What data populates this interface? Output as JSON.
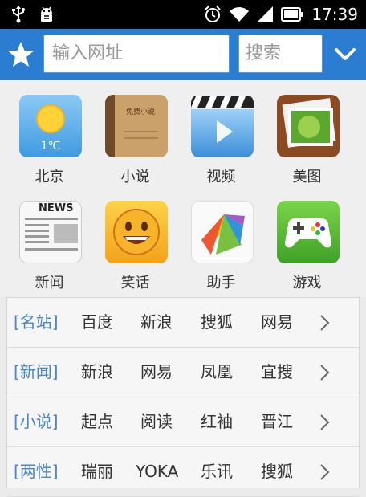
{
  "status_bar": {
    "time": "17:39",
    "icons": [
      "usb-icon",
      "android-debug-icon",
      "alarm-icon",
      "wifi-icon",
      "signal-icon",
      "battery-icon"
    ]
  },
  "toolbar": {
    "url_placeholder": "输入网址",
    "search_label": "搜索",
    "icons": [
      "star-icon",
      "chevron-down-icon"
    ]
  },
  "grid": {
    "items": [
      {
        "label": "北京",
        "icon": "weather-sun-icon",
        "badge": "1℃"
      },
      {
        "label": "小说",
        "icon": "book-icon",
        "badge": "免费小说"
      },
      {
        "label": "视频",
        "icon": "video-clapper-icon"
      },
      {
        "label": "美图",
        "icon": "photo-gallery-icon"
      },
      {
        "label": "新闻",
        "icon": "newspaper-icon",
        "badge": "NEWS"
      },
      {
        "label": "笑话",
        "icon": "smiley-icon"
      },
      {
        "label": "助手",
        "icon": "app-assistant-icon"
      },
      {
        "label": "游戏",
        "icon": "gamepad-icon"
      }
    ]
  },
  "links": {
    "rows": [
      {
        "category": "[名站]",
        "links": [
          "百度",
          "新浪",
          "搜狐",
          "网易"
        ]
      },
      {
        "category": "[新闻]",
        "links": [
          "新浪",
          "网易",
          "凤凰",
          "宜搜"
        ]
      },
      {
        "category": "[小说]",
        "links": [
          "起点",
          "阅读",
          "红袖",
          "晋江"
        ]
      },
      {
        "category": "[两性]",
        "links": [
          "瑞丽",
          "YOKA",
          "乐讯",
          "搜狐"
        ]
      }
    ]
  },
  "colors": {
    "toolbar": "#2a7dd0",
    "category_text": "#4a86c8",
    "status_bar": "#000000"
  }
}
